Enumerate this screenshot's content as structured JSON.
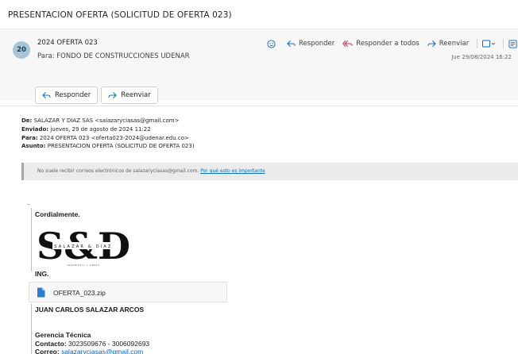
{
  "subject": "PRESENTACION OFERTA (SOLICITUD DE OFERTA 023)",
  "message": {
    "avatar_initials": "20",
    "sender": "2024 OFERTA 023",
    "to_label": "Para:",
    "to_value": "FONDO DE CONSTRUCCIONES UDENAR",
    "date": "Jue 29/08/2024 16:22"
  },
  "toolbar": {
    "reply": "Responder",
    "reply_all": "Responder a todos",
    "forward": "Reenviar"
  },
  "quick_actions": {
    "reply": "Responder",
    "forward": "Reenviar"
  },
  "forwarded_header": {
    "from_label": "De:",
    "from_value": "SALAZAR Y DIAZ SAS <salazaryciasas@gmail.com>",
    "sent_label": "Enviado:",
    "sent_value": "jueves, 29 de agosto de 2024 11:22",
    "to_label": "Para:",
    "to_value": "2024 OFERTA 023 <oferta023-2024@udenar.edu.co>",
    "subject_label": "Asunto:",
    "subject_value": "PRESENTACION OFERTA (SOLICITUD DE OFERTA 023)"
  },
  "notice": {
    "text": "No suele recibir correos electrónicos de salazaryciasas@gmail.com.",
    "link": "Por qué esto es importante"
  },
  "body": {
    "ellipsis": "--",
    "greeting": "Cordialmente.",
    "logo_mark": "S&D",
    "logo_text": "SALAZAR & DIAZ",
    "logo_tagline": "INGENIERÍA Y OBRAS",
    "title_line": "ING.",
    "attachment": "OFERTA_023.zip",
    "signer": "JUAN CARLOS SALAZAR ARCOS",
    "role": "Gerencia Técnica",
    "contact_label": "Contacto:",
    "contact_value": "3023509676 - 3006092693",
    "email_label": "Correo:",
    "email_value": "salazaryciasas@gmail.com"
  },
  "colors": {
    "accent": "#0f6cbd",
    "avatar_bg": "#a7c5d6",
    "reply_all_icon": "#c4314b",
    "forward_icon": "#0f6cbd"
  }
}
